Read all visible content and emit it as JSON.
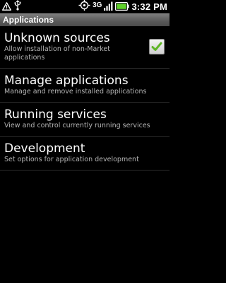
{
  "status_bar": {
    "network": "3G",
    "time": "3:32 PM",
    "icons": [
      "alert-icon",
      "usb-icon",
      "gps-icon",
      "signal-icon",
      "battery-icon"
    ]
  },
  "title": "Applications",
  "items": [
    {
      "title": "Unknown sources",
      "summary": "Allow installation of non-Market applications",
      "checked": true
    },
    {
      "title": "Manage applications",
      "summary": "Manage and remove installed applications"
    },
    {
      "title": "Running services",
      "summary": "View and control currently running services"
    },
    {
      "title": "Development",
      "summary": "Set options for application development"
    }
  ],
  "colors": {
    "background": "#000000",
    "title_bar": "#5b5b5b",
    "check": "#5fb526",
    "summary_text": "#b4b4b4",
    "battery": "#5fd02a"
  }
}
